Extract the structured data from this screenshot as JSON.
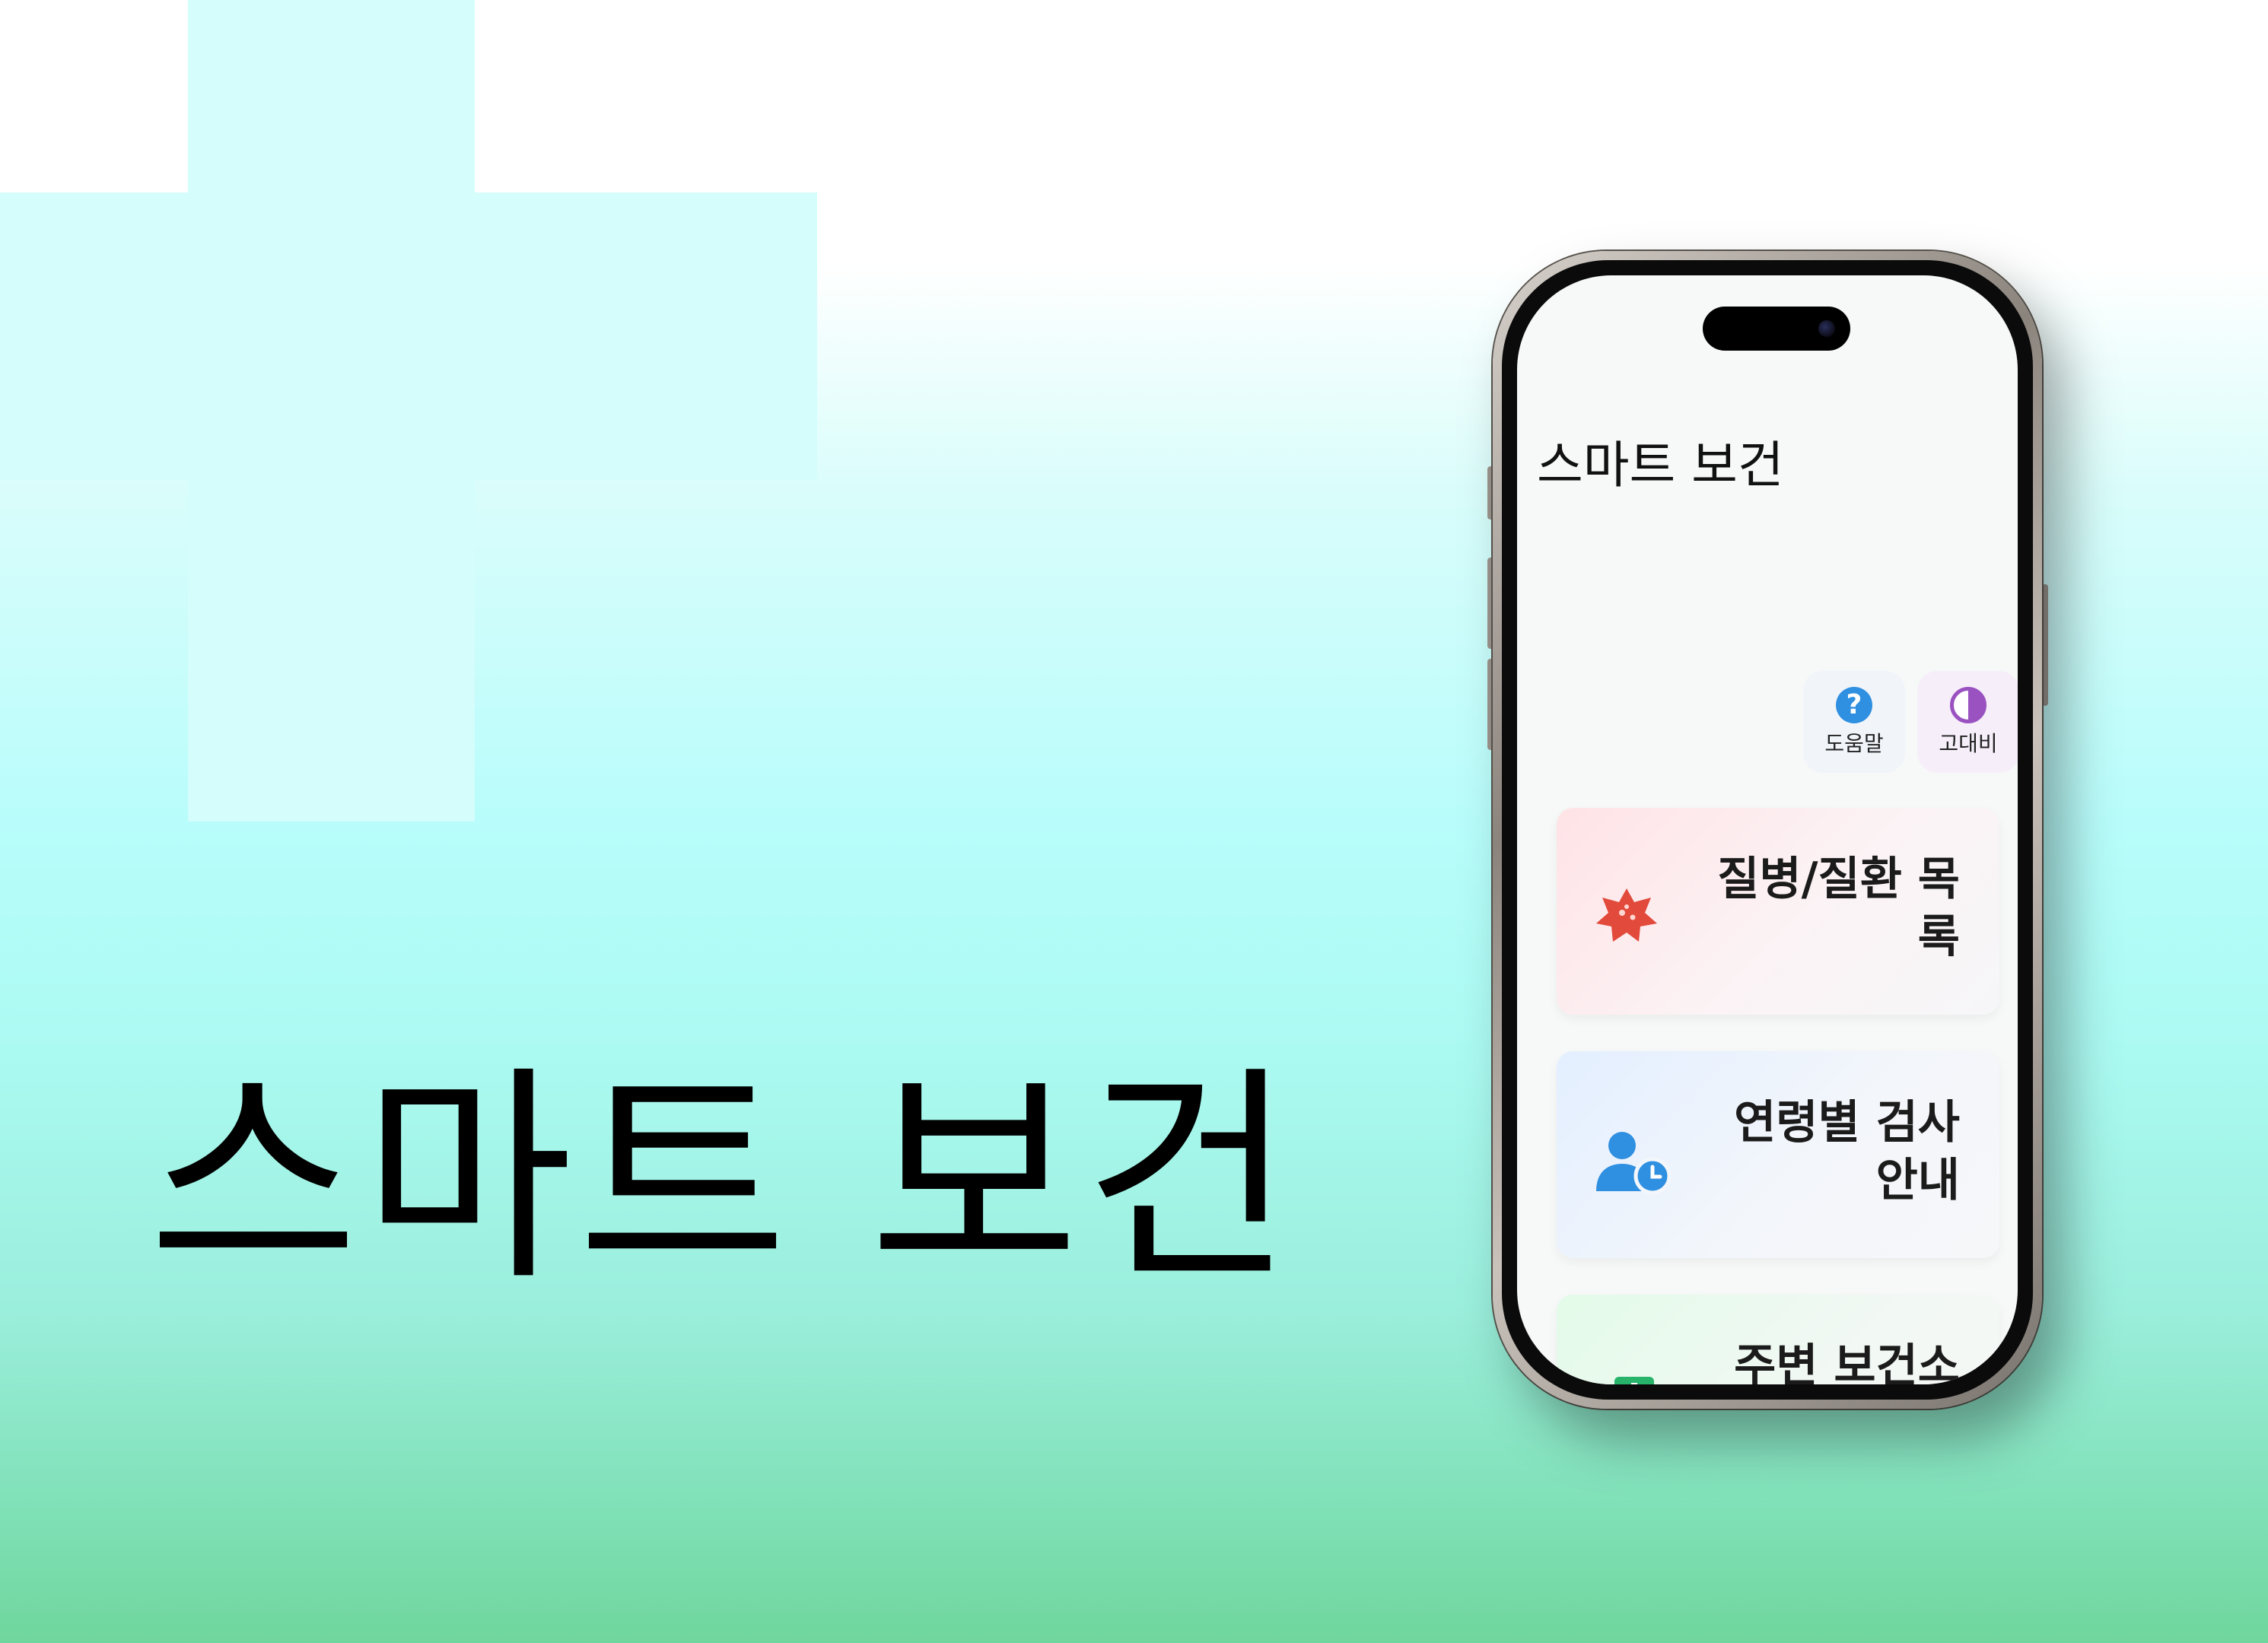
{
  "hero": {
    "title": "스마트 보건"
  },
  "app": {
    "title": "스마트 보건",
    "utility": [
      {
        "label": "도움말",
        "icon": "help-circle-icon",
        "glyph": "?",
        "color": "#2f8fe0"
      },
      {
        "label": "고대비",
        "icon": "contrast-icon",
        "color": "#9a52c0"
      }
    ],
    "cards": [
      {
        "label": "질병/질환 목록",
        "icon": "virus-icon",
        "color": "#e24a3b"
      },
      {
        "label": "연령별 검사 안내",
        "icon": "user-clock-icon",
        "color": "#2f8fe0"
      },
      {
        "label": "주변 보건소",
        "icon": "hospital-icon",
        "color": "#27b36a"
      }
    ]
  },
  "colors": {
    "background_top": "#ffffff",
    "background_mid": "#b8fdfb",
    "background_bottom": "#6fd69d",
    "cross": "#d4fdfb"
  }
}
